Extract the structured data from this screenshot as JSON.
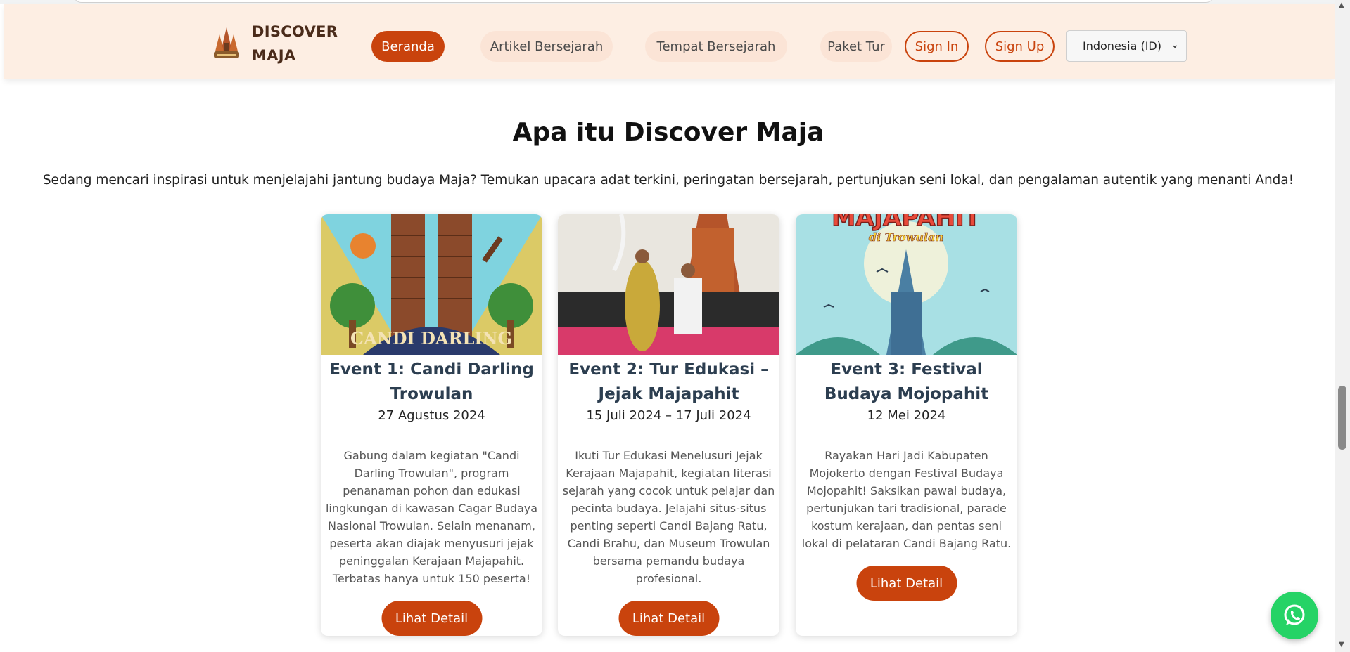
{
  "brand": {
    "name_line1": "DISCOVER",
    "name_line2": "MAJA"
  },
  "nav": {
    "items": [
      {
        "label": "Beranda",
        "active": true
      },
      {
        "label": "Artikel Bersejarah",
        "active": false
      },
      {
        "label": "Tempat Bersejarah",
        "active": false
      },
      {
        "label": "Paket Tur",
        "active": false
      }
    ],
    "sign_in": "Sign In",
    "sign_up": "Sign Up",
    "language": "Indonesia (ID)"
  },
  "section": {
    "title": "Apa itu Discover Maja",
    "subtitle": "Sedang mencari inspirasi untuk menjelajahi jantung budaya Maja? Temukan upacara adat terkini, peringatan bersejarah, pertunjukan seni lokal, dan pengalaman autentik yang menanti Anda!"
  },
  "events": [
    {
      "image_text": "CANDI DARLING",
      "title": "Event 1: Candi Darling Trowulan",
      "date": "27 Agustus 2024",
      "description": "Gabung dalam kegiatan \"Candi Darling Trowulan\", program penanaman pohon dan edukasi lingkungan di kawasan Cagar Budaya Nasional Trowulan. Selain menanam, peserta akan diajak menyusuri jejak peninggalan Kerajaan Majapahit. Terbatas hanya untuk 150 peserta!",
      "button": "Lihat Detail"
    },
    {
      "title": "Event 2: Tur Edukasi – Jejak Majapahit",
      "date": "15 Juli 2024 – 17 Juli 2024",
      "description": "Ikuti Tur Edukasi Menelusuri Jejak Kerajaan Majapahit, kegiatan literasi sejarah yang cocok untuk pelajar dan pecinta budaya. Jelajahi situs-situs penting seperti Candi Bajang Ratu, Candi Brahu, dan Museum Trowulan bersama pemandu budaya profesional.",
      "button": "Lihat Detail"
    },
    {
      "image_text": "MAJAPAHIT",
      "image_subtext": "di Trowulan",
      "title": "Event 3: Festival Budaya Mojopahit",
      "date": "12 Mei 2024",
      "description": "Rayakan Hari Jadi Kabupaten Mojokerto dengan Festival Budaya Mojopahit! Saksikan pawai budaya, pertunjukan tari tradisional, parade kostum kerajaan, dan pentas seni lokal di pelataran Candi Bajang Ratu.",
      "button": "Lihat Detail"
    }
  ],
  "colors": {
    "accent": "#c9430d",
    "navbar_bg": "#fdeee3",
    "whatsapp": "#25d366"
  }
}
